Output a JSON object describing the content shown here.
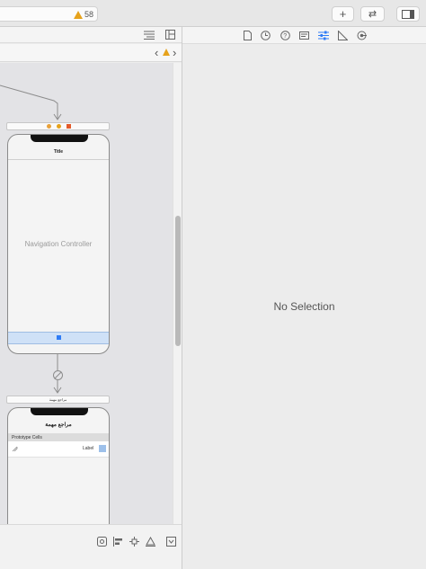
{
  "toolbar": {
    "warning_count": "58",
    "add_label": "+",
    "swap_label": "⇄",
    "panels_label": "▭"
  },
  "navigator": {
    "prev": "‹",
    "next": "›"
  },
  "canvas": {
    "nav_scene": {
      "title": "Title",
      "label": "Navigation Controller"
    },
    "table_scene": {
      "header_text": "مراجع مهمة",
      "title": "مراجع مهمة",
      "prototype_cells": "Prototype Cells",
      "cell_label": "Label"
    }
  },
  "inspector": {
    "empty_text": "No Selection",
    "tabs": [
      "file-icon",
      "history-icon",
      "help-icon",
      "identity-icon",
      "attributes-icon",
      "size-icon",
      "connections-icon"
    ]
  },
  "colors": {
    "accent": "#2f7cf6",
    "warning": "#e6a21b"
  }
}
